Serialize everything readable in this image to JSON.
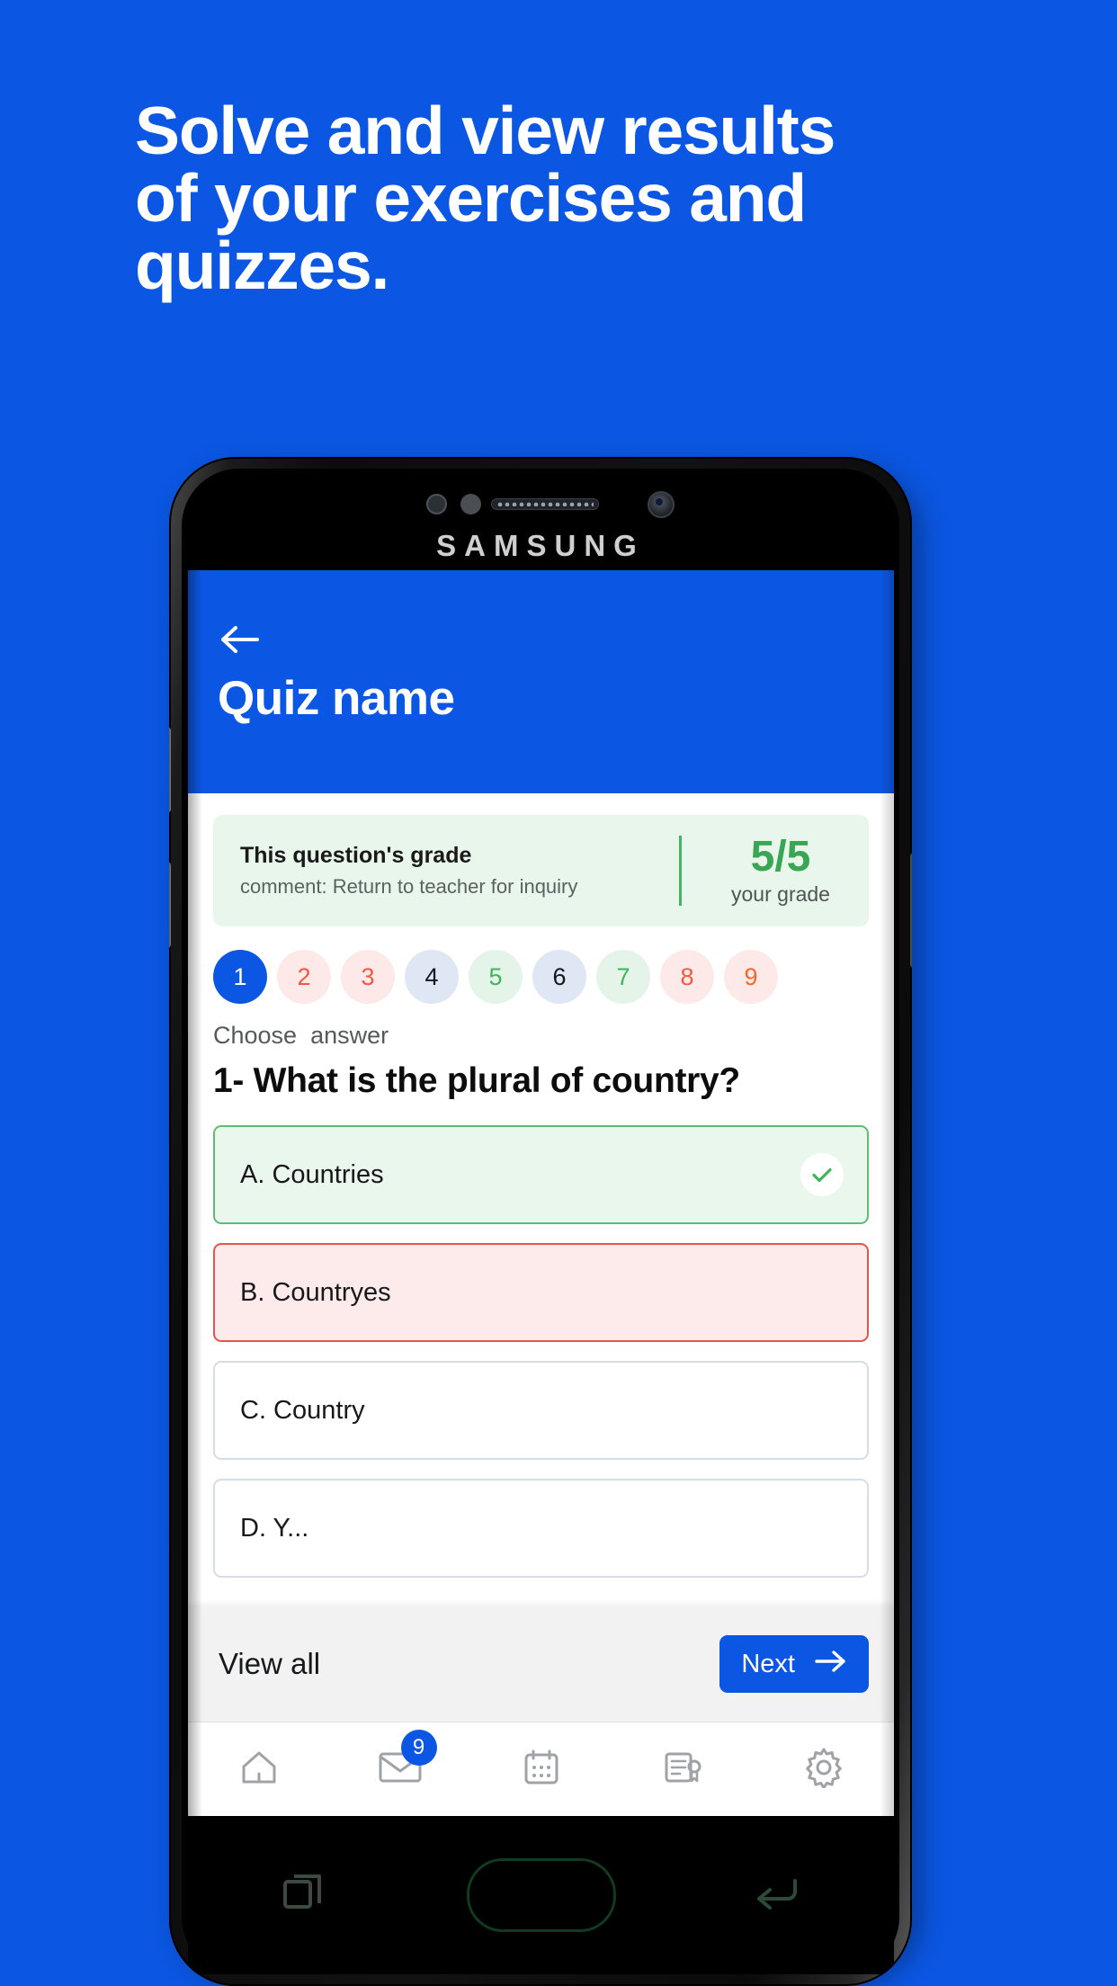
{
  "promo": {
    "headline_lines": [
      "Solve and view results",
      "of your exercises and",
      "quizzes."
    ],
    "background_color": "#0b57e3",
    "text_color": "#ffffff"
  },
  "device": {
    "brand": "SAMSUNG"
  },
  "app": {
    "header": {
      "title": "Quiz name",
      "back_icon": "back-arrow-icon",
      "background_color": "#0b57e3"
    },
    "grade_banner": {
      "title": "This question's grade",
      "comment": "comment: Return to teacher for inquiry",
      "score": "5/5",
      "score_label": "your grade",
      "accent_color": "#3aa552",
      "background_color": "#e9f6ec"
    },
    "pills": [
      {
        "number": "1",
        "state": "current",
        "bg": "#0b57e3",
        "fg": "#ffffff"
      },
      {
        "number": "2",
        "state": "wrong",
        "bg": "#fde9e7",
        "fg": "#ef5a44"
      },
      {
        "number": "3",
        "state": "wrong",
        "bg": "#fde9e7",
        "fg": "#ef5a44"
      },
      {
        "number": "4",
        "state": "neutral",
        "bg": "#dfe7f5",
        "fg": "#17181b"
      },
      {
        "number": "5",
        "state": "correct",
        "bg": "#e4f4e8",
        "fg": "#3fb45d"
      },
      {
        "number": "6",
        "state": "neutral",
        "bg": "#dfe7f5",
        "fg": "#17181b"
      },
      {
        "number": "7",
        "state": "correct",
        "bg": "#e4f4e8",
        "fg": "#3fb45d"
      },
      {
        "number": "8",
        "state": "wrong",
        "bg": "#fde9e7",
        "fg": "#ef5a44"
      },
      {
        "number": "9",
        "state": "wrong",
        "bg": "#fde9e7",
        "fg": "#ef6a2a"
      }
    ],
    "choose_label": "Choose  answer",
    "question": "1- What is the plural of country?",
    "options": [
      {
        "label": "A. Countries",
        "state": "correct",
        "has_check": true
      },
      {
        "label": "B. Countryes",
        "state": "wrong",
        "has_check": false
      },
      {
        "label": "C. Country",
        "state": "neutral",
        "has_check": false
      },
      {
        "label": "D. Y...",
        "state": "neutral",
        "has_check": false
      }
    ],
    "action_bar": {
      "view_all_label": "View all",
      "next_label": "Next",
      "next_icon": "arrow-right-icon",
      "next_color": "#0b57e3"
    },
    "bottom_nav": [
      {
        "icon": "home-icon",
        "badge": null
      },
      {
        "icon": "mail-icon",
        "badge": "9"
      },
      {
        "icon": "calendar-icon",
        "badge": null
      },
      {
        "icon": "certificate-icon",
        "badge": null
      },
      {
        "icon": "gear-icon",
        "badge": null
      }
    ]
  },
  "android_nav": {
    "recents_icon": "recents-icon",
    "home_icon": "home-pill-icon",
    "back_icon": "back-icon"
  }
}
